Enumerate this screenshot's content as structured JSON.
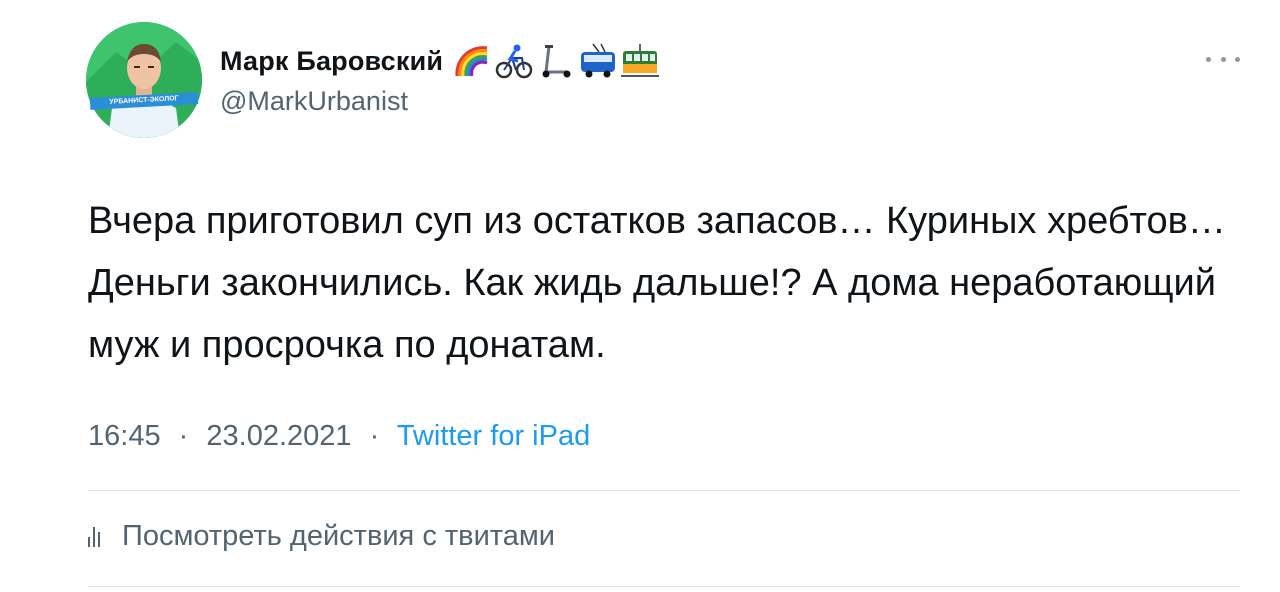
{
  "author": {
    "display_name": "Марк Баровский",
    "handle": "@MarkUrbanist",
    "avatar_badge": "УРБАНИСТ-ЭКОЛОГ",
    "name_emojis": [
      "rainbow-emoji",
      "cyclist-emoji",
      "kick-scooter-emoji",
      "trolleybus-emoji",
      "tram-emoji"
    ]
  },
  "tweet": {
    "text": "Вчера приготовил суп из остатков запасов… Куриных хребтов… Деньги закончились. Как жидь дальше!? А дома неработающий муж и просрочка по донатам.",
    "time": "16:45",
    "date": "23.02.2021",
    "separator": "·",
    "source": "Twitter for iPad"
  },
  "actions": {
    "view_activity_label": "Посмотреть действия с твитами"
  },
  "colors": {
    "text": "#0f1419",
    "secondary": "#536471",
    "link": "#1d9bf0",
    "avatar_bg": "#3ec46d"
  }
}
